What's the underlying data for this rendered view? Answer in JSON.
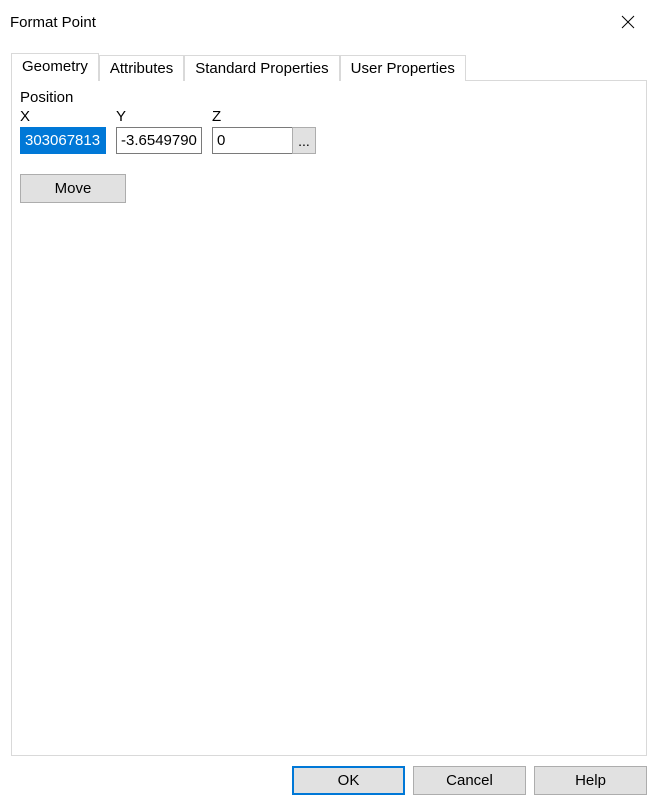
{
  "window": {
    "title": "Format Point"
  },
  "tabs": {
    "geometry": "Geometry",
    "attributes": "Attributes",
    "standard": "Standard Properties",
    "user": "User Properties"
  },
  "geometry": {
    "position_label": "Position",
    "x_label": "X",
    "y_label": "Y",
    "z_label": "Z",
    "x_value": "303067813",
    "y_value": "-3.6549790",
    "z_value": "0",
    "ellipsis": "...",
    "move_label": "Move"
  },
  "buttons": {
    "ok": "OK",
    "cancel": "Cancel",
    "help": "Help"
  }
}
